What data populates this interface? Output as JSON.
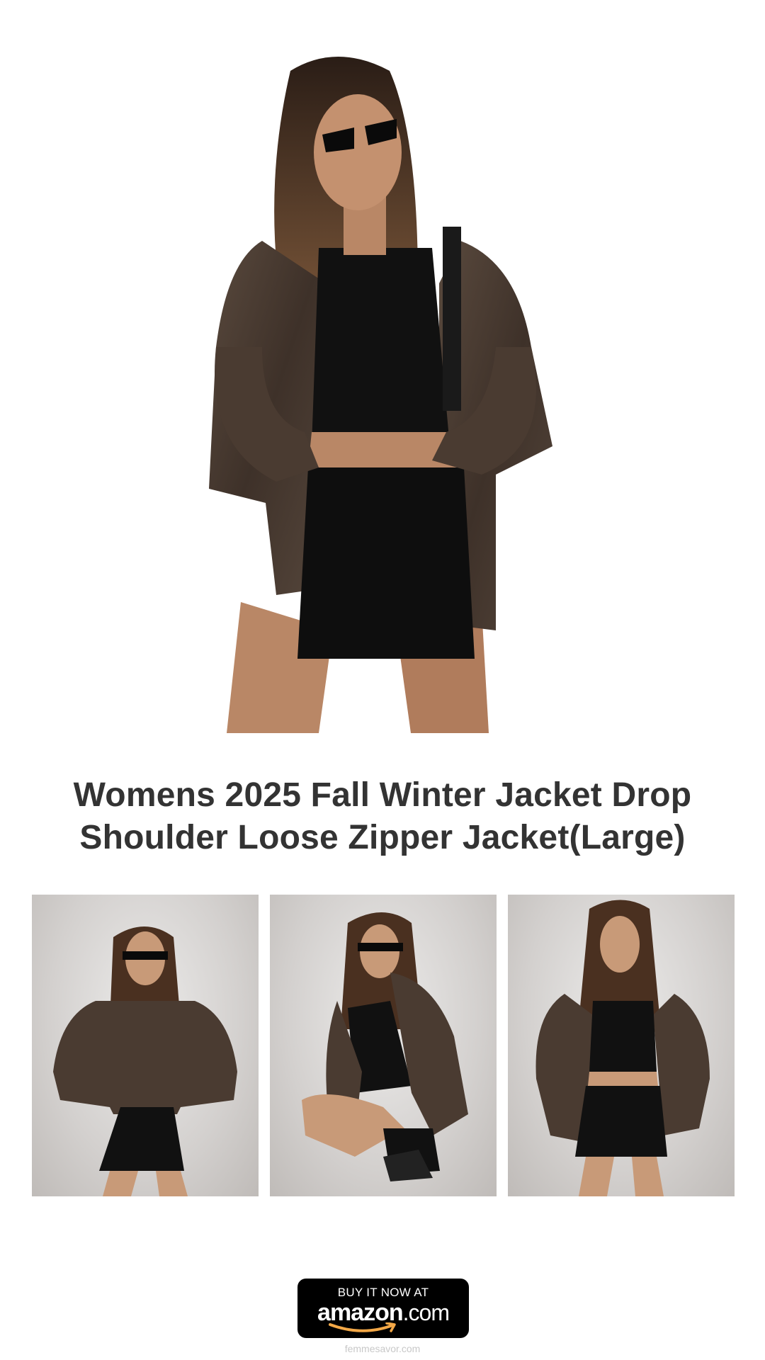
{
  "product": {
    "title": "Womens 2025 Fall Winter Jacket Drop Shoulder Loose Zipper Jacket(Large)"
  },
  "hero_image": {
    "description_icon": "model-in-brown-leather-jacket"
  },
  "gallery": {
    "images": [
      {
        "icon": "model-standing-front-jacket"
      },
      {
        "icon": "model-crouching-jacket"
      },
      {
        "icon": "model-standing-open-jacket"
      }
    ]
  },
  "cta": {
    "buy_line": "BUY IT NOW AT",
    "brand_name": "amazon",
    "brand_tld": ".com"
  },
  "footer": {
    "site": "femmesavor.com"
  },
  "colors": {
    "title_text": "#333333",
    "button_bg": "#000000",
    "amazon_smile": "#f3a847",
    "jacket": "#4a3b31"
  }
}
